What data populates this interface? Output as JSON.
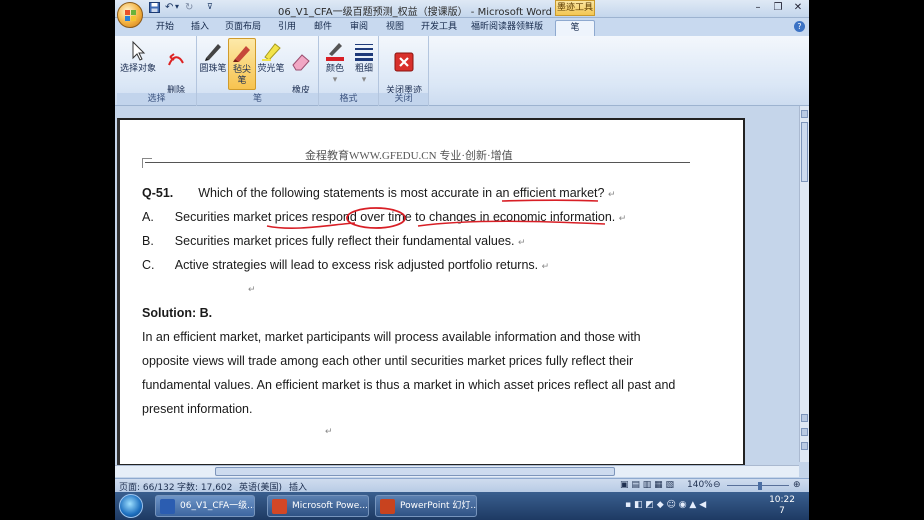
{
  "window": {
    "title": "06_V1_CFA一级百题预测_权益（搜课版） - Microsoft Word",
    "context_tab": "墨迹工具"
  },
  "tabs": [
    "开始",
    "插入",
    "页面布局",
    "引用",
    "邮件",
    "审阅",
    "视图",
    "开发工具",
    "福昕阅读器领鲜版",
    "笔"
  ],
  "ribbon": {
    "group_select": {
      "label": "选择",
      "buttons": [
        "选择对象",
        "删除\n所有墨迹"
      ]
    },
    "group_pen": {
      "label": "笔",
      "buttons": [
        "圆珠笔",
        "毡尖笔",
        "荧光笔",
        "橡皮\n擦"
      ]
    },
    "group_format": {
      "label": "格式",
      "buttons": [
        "颜色",
        "粗细"
      ]
    },
    "group_close": {
      "label": "关闭",
      "buttons": [
        "关闭墨迹\n书写工具"
      ]
    }
  },
  "document": {
    "header": "金程教育WWW.GFEDU.CN 专业·创新·增值",
    "question_label": "Q-51.",
    "question_text": "Which of the following statements is most accurate in an efficient market?",
    "options": [
      {
        "label": "A.",
        "text": "Securities market prices respond over time to changes in economic information."
      },
      {
        "label": "B.",
        "text": "Securities market prices fully reflect their fundamental values."
      },
      {
        "label": "C.",
        "text": "Active strategies will lead to excess risk adjusted portfolio returns."
      }
    ],
    "solution_label": "Solution: B.",
    "solution_lines": [
      "In an efficient market, market participants will process available information and those with",
      "opposite views will trade among each other until securities market prices fully reflect their",
      "fundamental values. An efficient market is thus a market in which asset prices reflect all past and",
      "present information."
    ],
    "ink_color": "#d81f26"
  },
  "statusbar": {
    "page": "页面: 66/132",
    "words": "字数: 17,602",
    "language": "英语(美国)",
    "mode": "插入",
    "zoom": "140%"
  },
  "taskbar": {
    "tasks": [
      "06_V1_CFA一级...",
      "Microsoft Powe...",
      "PowerPoint 幻灯..."
    ],
    "time": "10:22",
    "date": "7"
  }
}
